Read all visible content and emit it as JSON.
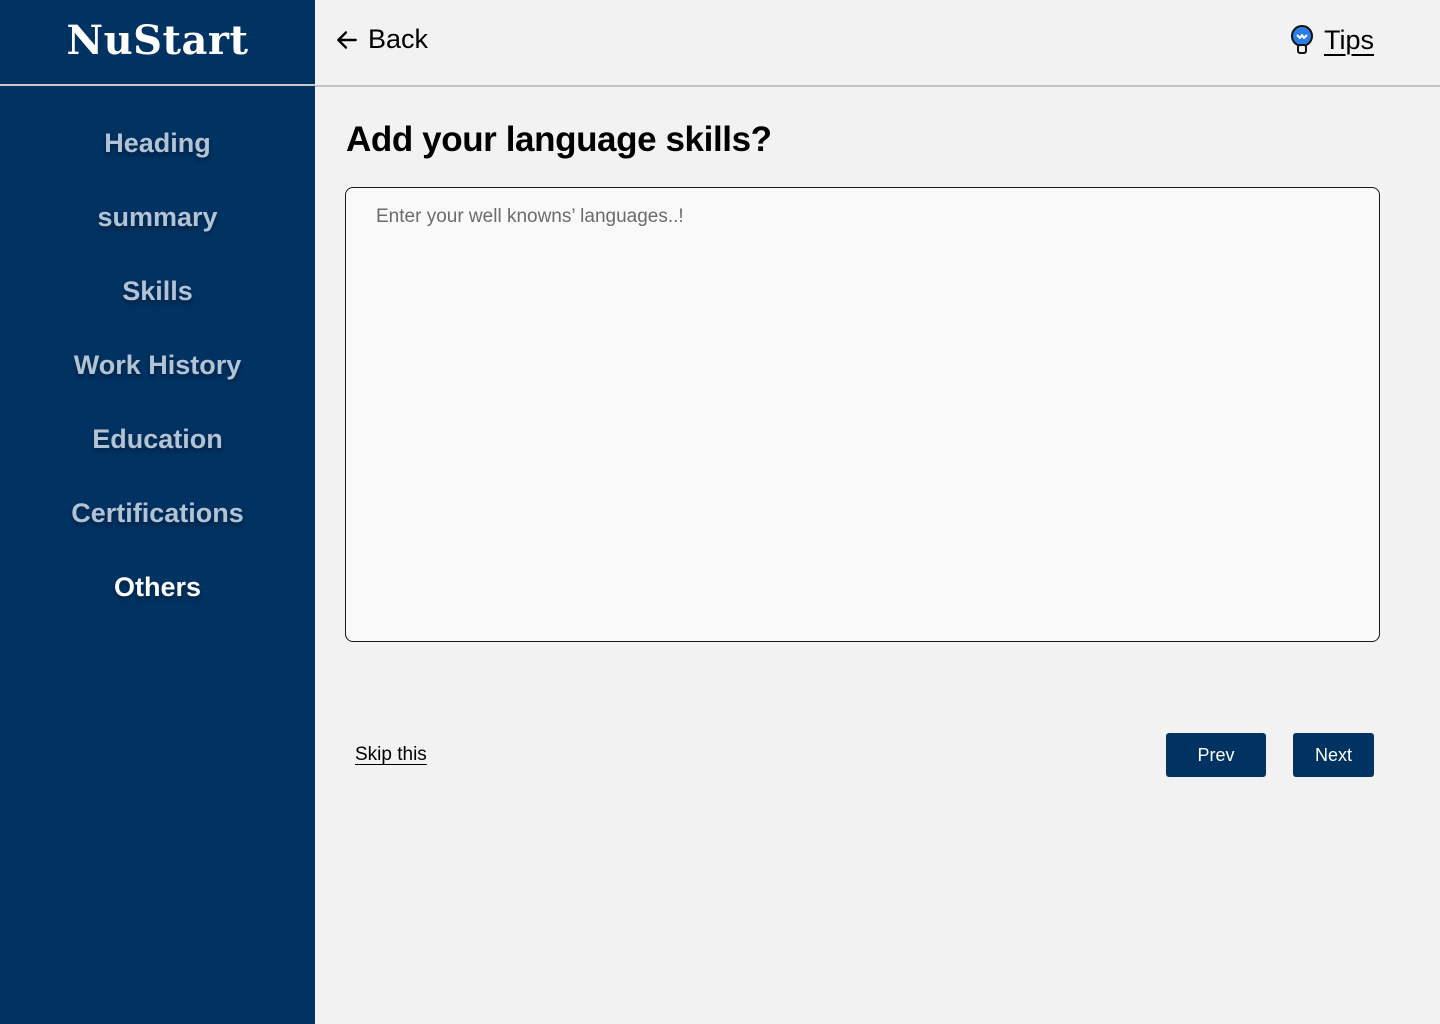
{
  "app": {
    "brand": "NuStart"
  },
  "sidebar": {
    "items": [
      {
        "label": "Heading"
      },
      {
        "label": "summary"
      },
      {
        "label": "Skills"
      },
      {
        "label": "Work History"
      },
      {
        "label": "Education"
      },
      {
        "label": "Certifications"
      },
      {
        "label": "Others"
      }
    ],
    "active": "Others"
  },
  "header": {
    "back_label": "Back",
    "tips_label": "Tips"
  },
  "main": {
    "title": "Add your language skills?",
    "input": {
      "value": "",
      "placeholder": "Enter your well knowns’ languages..!"
    }
  },
  "footer": {
    "skip_label": "Skip this",
    "prev_label": "Prev",
    "next_label": "Next"
  },
  "colors": {
    "primary": "#003262",
    "nav_inactive": "#b2c3d6",
    "nav_active": "#ffffff",
    "background": "#f2f2f2",
    "tip_bulb": "#2b7de9"
  },
  "icons": {
    "back": "arrow-left-icon",
    "tips": "lightbulb-icon"
  }
}
